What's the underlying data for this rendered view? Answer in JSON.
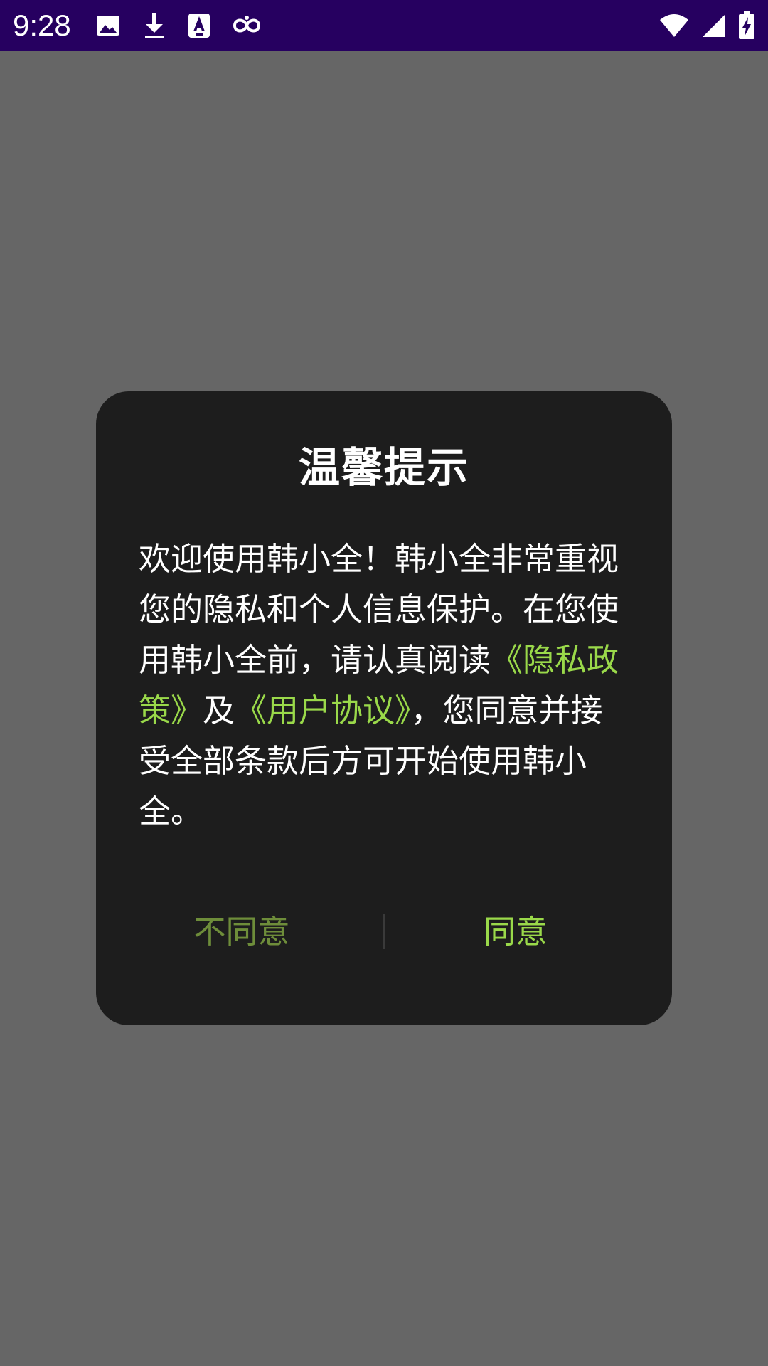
{
  "status_bar": {
    "time": "9:28",
    "left_icons": [
      "image-icon",
      "download-icon",
      "font-icon",
      "link-icon"
    ],
    "right_icons": [
      "wifi-icon",
      "signal-icon",
      "battery-charging-icon"
    ]
  },
  "dialog": {
    "title": "温馨提示",
    "body": {
      "part1": "欢迎使用韩小全！韩小全非常重视您的隐私和个人信息保护。在您使用韩小全前，请认真阅读",
      "privacy_link": "《隐私政策》",
      "and": "及",
      "agreement_link": "《用户协议》",
      "part2": "，您同意并接受全部条款后方可开始使用韩小全。"
    },
    "disagree_label": "不同意",
    "agree_label": "同意"
  },
  "colors": {
    "status_bar": "#260060",
    "backdrop": "#666666",
    "dialog_bg": "#1d1d1d",
    "accent": "#9ad94a",
    "accent_dim": "#6e8d3a"
  }
}
